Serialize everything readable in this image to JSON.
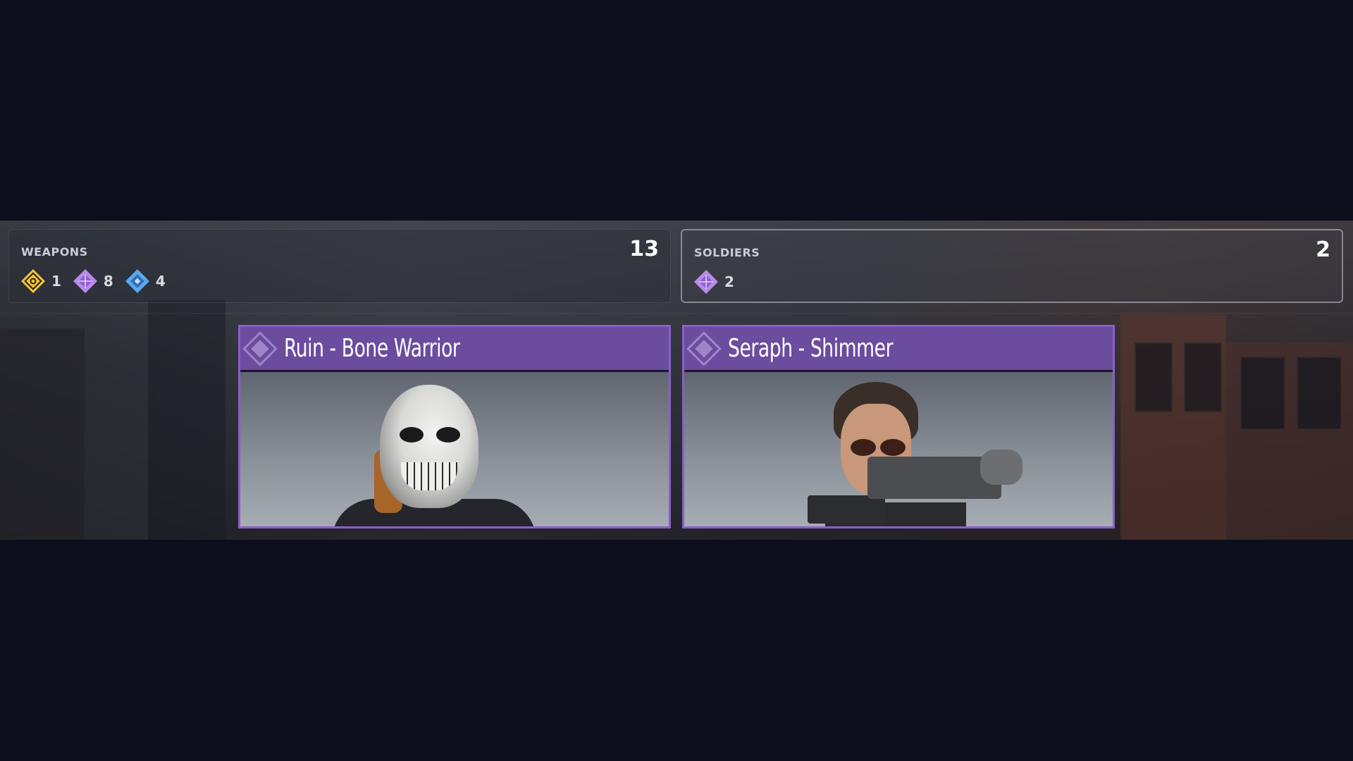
{
  "summary": {
    "weapons": {
      "label": "WEAPONS",
      "total": "13",
      "rarities": [
        {
          "icon": "gold-rarity-diamond-icon",
          "color": "#f2c53a",
          "count": "1"
        },
        {
          "icon": "purple-rarity-diamond-icon",
          "color": "#b889ec",
          "count": "8"
        },
        {
          "icon": "blue-rarity-diamond-icon",
          "color": "#5aa8ee",
          "count": "4"
        }
      ]
    },
    "soldiers": {
      "label": "SOLDIERS",
      "total": "2",
      "rarities": [
        {
          "icon": "purple-rarity-diamond-icon",
          "color": "#b889ec",
          "count": "2"
        }
      ]
    }
  },
  "cards": [
    {
      "title": "Ruin - Bone Warrior",
      "rarity_color": "#6b4c9e",
      "icon": "purple-rarity-diamond-icon"
    },
    {
      "title": "Seraph - Shimmer",
      "rarity_color": "#6b4c9e",
      "icon": "purple-rarity-diamond-icon"
    }
  ],
  "colors": {
    "background": "#0c0f1b",
    "epic_border": "#8a5fc9",
    "epic_header": "#6b4c9e"
  }
}
